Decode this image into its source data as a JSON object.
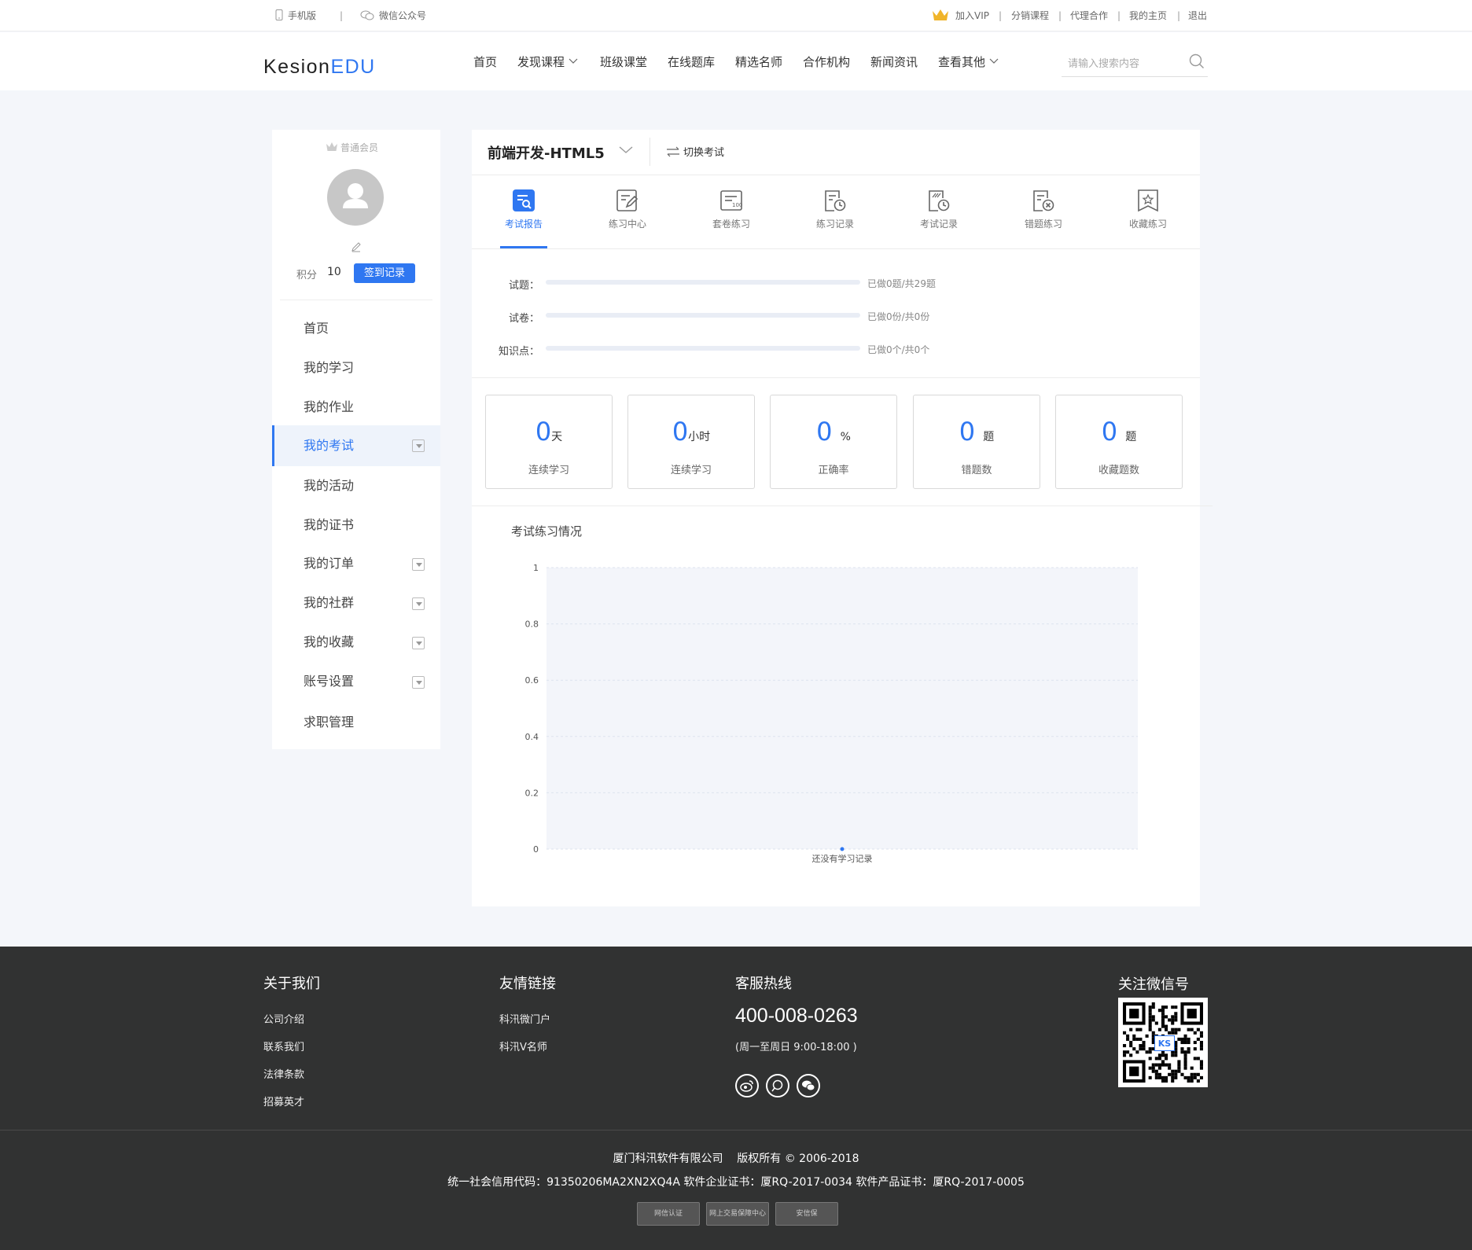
{
  "topbar": {
    "mobile": "手机版",
    "wechat_account": "微信公众号",
    "join_vip": "加入VIP",
    "distribution": "分销课程",
    "agent": "代理合作",
    "homepage": "我的主页",
    "logout": "退出",
    "separator": "|"
  },
  "header": {
    "logo_main": "Kesion",
    "logo_accent": "EDU",
    "nav": [
      "首页",
      "发现课程",
      "班级课堂",
      "在线题库",
      "精选名师",
      "合作机构",
      "新闻资讯",
      "查看其他"
    ],
    "search_placeholder": "请输入搜索内容"
  },
  "sidebar": {
    "member_level": "普通会员",
    "points_label": "积分",
    "points_value": "10",
    "checkin_button": "签到记录",
    "items": [
      {
        "label": "首页"
      },
      {
        "label": "我的学习"
      },
      {
        "label": "我的作业"
      },
      {
        "label": "我的考试",
        "active": true
      },
      {
        "label": "我的活动"
      },
      {
        "label": "我的证书"
      },
      {
        "label": "我的订单"
      },
      {
        "label": "我的社群"
      },
      {
        "label": "我的收藏"
      },
      {
        "label": "账号设置"
      },
      {
        "label": "求职管理"
      }
    ]
  },
  "exam": {
    "title": "前端开发-HTML5",
    "switch_label": "切换考试",
    "tabs": [
      {
        "label": "考试报告",
        "icon": "report-icon",
        "active": true
      },
      {
        "label": "练习中心",
        "icon": "practice-icon"
      },
      {
        "label": "套卷练习",
        "icon": "paper-icon"
      },
      {
        "label": "练习记录",
        "icon": "practice-record-icon"
      },
      {
        "label": "考试记录",
        "icon": "exam-record-icon"
      },
      {
        "label": "错题练习",
        "icon": "wrong-question-icon"
      },
      {
        "label": "收藏练习",
        "icon": "favorite-icon"
      }
    ],
    "progress": [
      {
        "label": "试题：",
        "text": "已做0题/共29题",
        "fraction": 0
      },
      {
        "label": "试卷：",
        "text": "已做0份/共0份",
        "fraction": 0
      },
      {
        "label": "知识点：",
        "text": "已做0个/共0个",
        "fraction": 0
      }
    ],
    "stats": [
      {
        "value": "0",
        "unit": "天",
        "label": "连续学习"
      },
      {
        "value": "0",
        "unit": "小时",
        "label": "连续学习"
      },
      {
        "value": "0",
        "unit": "%",
        "label": "正确率"
      },
      {
        "value": "0",
        "unit": "题",
        "label": "错题数"
      },
      {
        "value": "0",
        "unit": "题",
        "label": "收藏题数"
      }
    ]
  },
  "chart_data": {
    "type": "line",
    "title": "考试练习情况",
    "y_ticks": [
      "0",
      "0.2",
      "0.4",
      "0.6",
      "0.8",
      "1"
    ],
    "ylim": [
      0,
      1
    ],
    "categories": [
      "还没有学习记录"
    ],
    "series": [
      {
        "values": [
          0
        ]
      }
    ],
    "grid": true,
    "colors": {
      "point": "#2f77f1",
      "plot_bg": "#f3f5fa",
      "grid": "#dde3ee"
    }
  },
  "footer": {
    "about_title": "关于我们",
    "about_links": [
      "公司介绍",
      "联系我们",
      "法律条款",
      "招募英才"
    ],
    "friend_title": "友情链接",
    "friend_links": [
      "科汛微门户",
      "科汛V名师"
    ],
    "hotline_title": "客服热线",
    "hotline_number": "400-008-0263",
    "hotline_hours": "(周一至周日 9:00-18:00 )",
    "social_icons": [
      "weibo-icon",
      "search-icon",
      "wechat-icon"
    ],
    "wechat_title": "关注微信号",
    "qr_logo": "KS",
    "copyright": "厦门科汛软件有限公司    版权所有 © 2006-2018",
    "license": "统一社会信用代码：91350206MA2XN2XQ4A 软件企业证书：厦RQ-2017-0034 软件产品证书：厦RQ-2017-0005",
    "badges": [
      "网信认证",
      "网上交易保障中心",
      "安信保"
    ]
  }
}
